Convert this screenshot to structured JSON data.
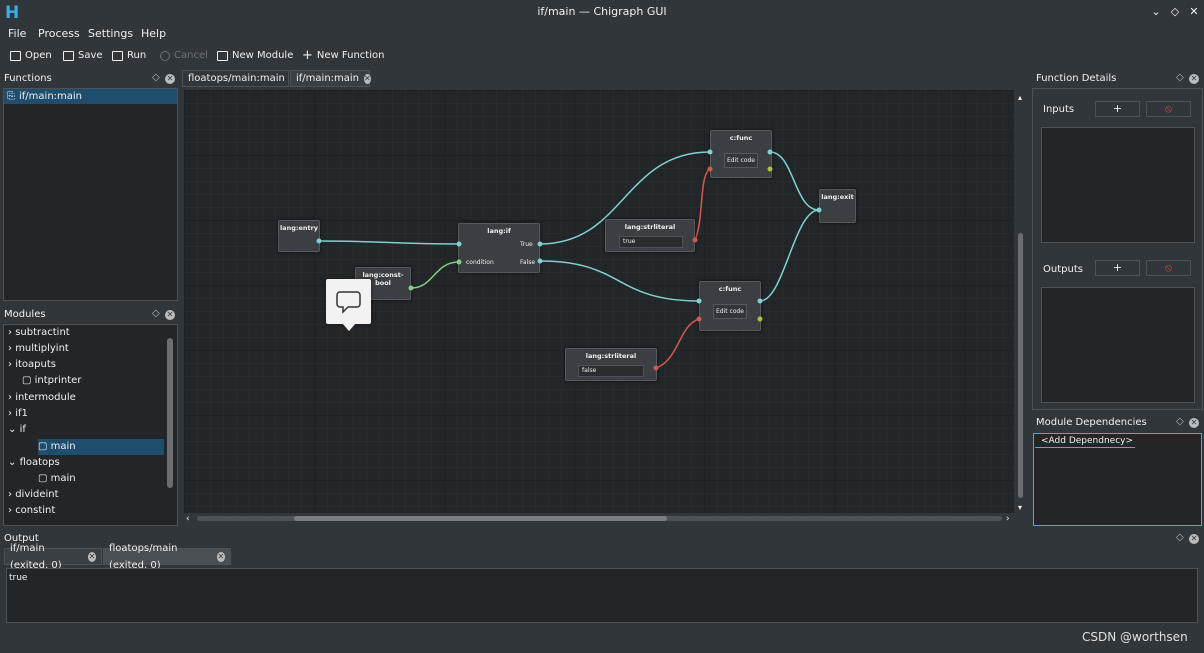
{
  "window": {
    "title": "if/main — Chigraph GUI",
    "logo": "H"
  },
  "menu": [
    "File",
    "Process",
    "Settings",
    "Help"
  ],
  "toolbar": {
    "open": "Open",
    "save": "Save",
    "run": "Run",
    "cancel": "Cancel",
    "new_module": "New Module",
    "new_function": "New Function"
  },
  "functions_panel": {
    "title": "Functions",
    "items": [
      "if/main:main"
    ]
  },
  "modules_panel": {
    "title": "Modules",
    "items": [
      "subtractint",
      "multiplyint",
      "itoaputs",
      "intprinter",
      "intermodule",
      "if1",
      "if",
      "main",
      "floatops",
      "main",
      "divideint",
      "constint"
    ]
  },
  "editor_tabs": [
    "floatops/main:main",
    "if/main:main"
  ],
  "nodes": {
    "entry": "lang:entry",
    "constbool": "lang:const-bool",
    "if": "lang:if",
    "if_true": "True",
    "if_false": "False",
    "if_condition": "condition",
    "cfunc1": "c:func",
    "cfunc1_btn": "Edit code",
    "cfunc2": "c:func",
    "cfunc2_btn": "Edit code",
    "exit": "lang:exit",
    "str1": "lang:strliteral",
    "str1_val": "true",
    "str2": "lang:strliteral",
    "str2_val": "false"
  },
  "function_details": {
    "title": "Function Details",
    "inputs": "Inputs",
    "outputs": "Outputs",
    "add": "+",
    "remove": "⦸"
  },
  "module_deps": {
    "title": "Module Dependencies",
    "add": "<Add Dependnecy>"
  },
  "output": {
    "title": "Output",
    "tabs": [
      "if/main (exited, 0)",
      "floatops/main (exited, 0)"
    ],
    "text": "true"
  },
  "watermark": "CSDN @worthsen",
  "colors": {
    "accent": "#3daee9",
    "wire_exec": "#7fd0d0",
    "wire_bool": "#7ed07e",
    "wire_str": "#d05a4e"
  }
}
